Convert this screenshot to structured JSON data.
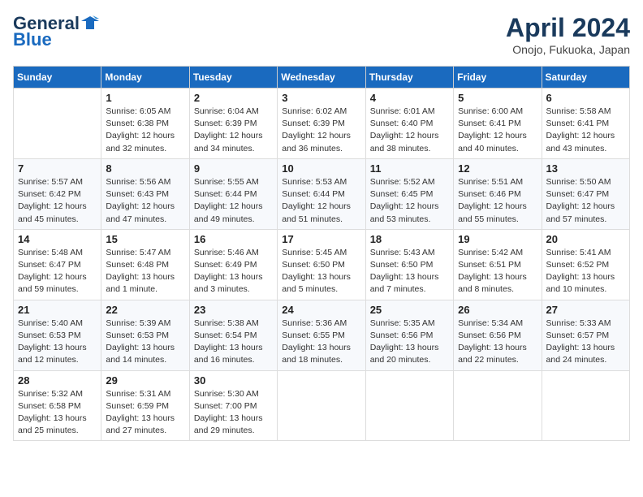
{
  "header": {
    "logo_general": "General",
    "logo_blue": "Blue",
    "month_title": "April 2024",
    "location": "Onojo, Fukuoka, Japan"
  },
  "days_of_week": [
    "Sunday",
    "Monday",
    "Tuesday",
    "Wednesday",
    "Thursday",
    "Friday",
    "Saturday"
  ],
  "weeks": [
    [
      {
        "day": "",
        "info": ""
      },
      {
        "day": "1",
        "info": "Sunrise: 6:05 AM\nSunset: 6:38 PM\nDaylight: 12 hours\nand 32 minutes."
      },
      {
        "day": "2",
        "info": "Sunrise: 6:04 AM\nSunset: 6:39 PM\nDaylight: 12 hours\nand 34 minutes."
      },
      {
        "day": "3",
        "info": "Sunrise: 6:02 AM\nSunset: 6:39 PM\nDaylight: 12 hours\nand 36 minutes."
      },
      {
        "day": "4",
        "info": "Sunrise: 6:01 AM\nSunset: 6:40 PM\nDaylight: 12 hours\nand 38 minutes."
      },
      {
        "day": "5",
        "info": "Sunrise: 6:00 AM\nSunset: 6:41 PM\nDaylight: 12 hours\nand 40 minutes."
      },
      {
        "day": "6",
        "info": "Sunrise: 5:58 AM\nSunset: 6:41 PM\nDaylight: 12 hours\nand 43 minutes."
      }
    ],
    [
      {
        "day": "7",
        "info": "Sunrise: 5:57 AM\nSunset: 6:42 PM\nDaylight: 12 hours\nand 45 minutes."
      },
      {
        "day": "8",
        "info": "Sunrise: 5:56 AM\nSunset: 6:43 PM\nDaylight: 12 hours\nand 47 minutes."
      },
      {
        "day": "9",
        "info": "Sunrise: 5:55 AM\nSunset: 6:44 PM\nDaylight: 12 hours\nand 49 minutes."
      },
      {
        "day": "10",
        "info": "Sunrise: 5:53 AM\nSunset: 6:44 PM\nDaylight: 12 hours\nand 51 minutes."
      },
      {
        "day": "11",
        "info": "Sunrise: 5:52 AM\nSunset: 6:45 PM\nDaylight: 12 hours\nand 53 minutes."
      },
      {
        "day": "12",
        "info": "Sunrise: 5:51 AM\nSunset: 6:46 PM\nDaylight: 12 hours\nand 55 minutes."
      },
      {
        "day": "13",
        "info": "Sunrise: 5:50 AM\nSunset: 6:47 PM\nDaylight: 12 hours\nand 57 minutes."
      }
    ],
    [
      {
        "day": "14",
        "info": "Sunrise: 5:48 AM\nSunset: 6:47 PM\nDaylight: 12 hours\nand 59 minutes."
      },
      {
        "day": "15",
        "info": "Sunrise: 5:47 AM\nSunset: 6:48 PM\nDaylight: 13 hours\nand 1 minute."
      },
      {
        "day": "16",
        "info": "Sunrise: 5:46 AM\nSunset: 6:49 PM\nDaylight: 13 hours\nand 3 minutes."
      },
      {
        "day": "17",
        "info": "Sunrise: 5:45 AM\nSunset: 6:50 PM\nDaylight: 13 hours\nand 5 minutes."
      },
      {
        "day": "18",
        "info": "Sunrise: 5:43 AM\nSunset: 6:50 PM\nDaylight: 13 hours\nand 7 minutes."
      },
      {
        "day": "19",
        "info": "Sunrise: 5:42 AM\nSunset: 6:51 PM\nDaylight: 13 hours\nand 8 minutes."
      },
      {
        "day": "20",
        "info": "Sunrise: 5:41 AM\nSunset: 6:52 PM\nDaylight: 13 hours\nand 10 minutes."
      }
    ],
    [
      {
        "day": "21",
        "info": "Sunrise: 5:40 AM\nSunset: 6:53 PM\nDaylight: 13 hours\nand 12 minutes."
      },
      {
        "day": "22",
        "info": "Sunrise: 5:39 AM\nSunset: 6:53 PM\nDaylight: 13 hours\nand 14 minutes."
      },
      {
        "day": "23",
        "info": "Sunrise: 5:38 AM\nSunset: 6:54 PM\nDaylight: 13 hours\nand 16 minutes."
      },
      {
        "day": "24",
        "info": "Sunrise: 5:36 AM\nSunset: 6:55 PM\nDaylight: 13 hours\nand 18 minutes."
      },
      {
        "day": "25",
        "info": "Sunrise: 5:35 AM\nSunset: 6:56 PM\nDaylight: 13 hours\nand 20 minutes."
      },
      {
        "day": "26",
        "info": "Sunrise: 5:34 AM\nSunset: 6:56 PM\nDaylight: 13 hours\nand 22 minutes."
      },
      {
        "day": "27",
        "info": "Sunrise: 5:33 AM\nSunset: 6:57 PM\nDaylight: 13 hours\nand 24 minutes."
      }
    ],
    [
      {
        "day": "28",
        "info": "Sunrise: 5:32 AM\nSunset: 6:58 PM\nDaylight: 13 hours\nand 25 minutes."
      },
      {
        "day": "29",
        "info": "Sunrise: 5:31 AM\nSunset: 6:59 PM\nDaylight: 13 hours\nand 27 minutes."
      },
      {
        "day": "30",
        "info": "Sunrise: 5:30 AM\nSunset: 7:00 PM\nDaylight: 13 hours\nand 29 minutes."
      },
      {
        "day": "",
        "info": ""
      },
      {
        "day": "",
        "info": ""
      },
      {
        "day": "",
        "info": ""
      },
      {
        "day": "",
        "info": ""
      }
    ]
  ]
}
